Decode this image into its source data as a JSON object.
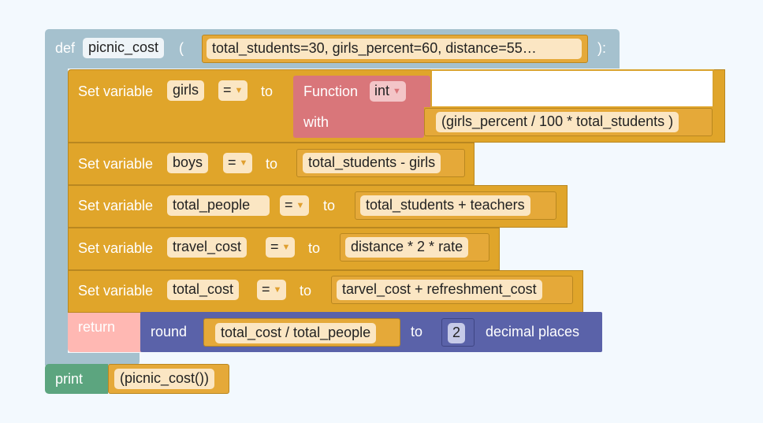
{
  "def_block": {
    "def_label": "def",
    "func_name": "picnic_cost",
    "open_paren": "(",
    "params": "total_students=30, girls_percent=60, distance=55…",
    "close_paren": "):"
  },
  "statements": [
    {
      "set_label": "Set variable",
      "var": "girls",
      "op": "=",
      "to": "to"
    },
    {
      "set_label": "Set variable",
      "var": "boys",
      "op": "=",
      "to": "to",
      "value": "total_students - girls"
    },
    {
      "set_label": "Set variable",
      "var": "total_people",
      "op": "=",
      "to": "to",
      "value": "total_students + teachers"
    },
    {
      "set_label": "Set variable",
      "var": "travel_cost",
      "op": "=",
      "to": "to",
      "value": "distance * 2 * rate"
    },
    {
      "set_label": "Set variable",
      "var": "total_cost",
      "op": "=",
      "to": "to",
      "value": "tarvel_cost + refreshment_cost"
    }
  ],
  "function_block": {
    "function_label": "Function",
    "function_name": "int",
    "with_label": "with",
    "argument": "(girls_percent / 100 * total_students )"
  },
  "return_block": {
    "return_label": "return",
    "round_label": "round",
    "expression": "total_cost / total_people",
    "to_label": "to",
    "places_value": "2",
    "places_label": "decimal places"
  },
  "print_block": {
    "print_label": "print",
    "argument": "(picnic_cost())"
  },
  "colors": {
    "def_block": "#a5c1ce",
    "statement_block": "#e0a52a",
    "function_block": "#d9767a",
    "return_block": "#ffb8b3",
    "round_block": "#5a62a9",
    "print_block": "#5ca57f"
  }
}
